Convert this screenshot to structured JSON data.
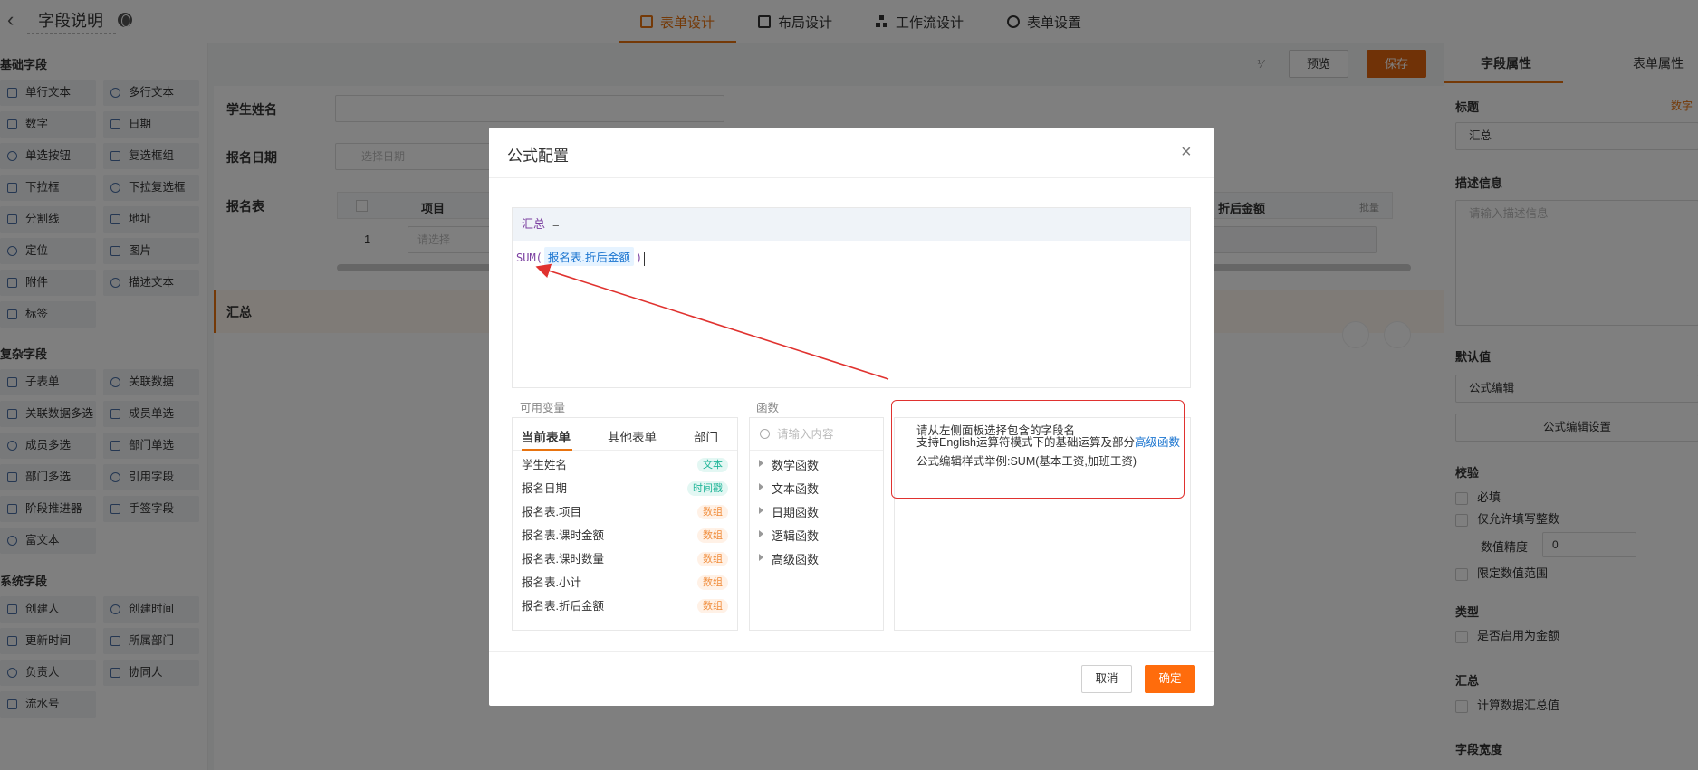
{
  "header": {
    "title": "字段说明",
    "tabs": [
      {
        "label": "表单设计",
        "active": true
      },
      {
        "label": "布局设计",
        "active": false
      },
      {
        "label": "工作流设计",
        "active": false
      },
      {
        "label": "表单设置",
        "active": false
      }
    ]
  },
  "palette": {
    "basic_title": "基础字段",
    "basic": [
      "单行文本",
      "多行文本",
      "数字",
      "日期",
      "单选按钮",
      "复选框组",
      "下拉框",
      "下拉复选框",
      "分割线",
      "地址",
      "定位",
      "图片",
      "附件",
      "描述文本",
      "标签"
    ],
    "complex_title": "复杂字段",
    "complex": [
      "子表单",
      "关联数据",
      "关联数据多选",
      "成员单选",
      "成员多选",
      "部门单选",
      "部门多选",
      "引用字段",
      "阶段推进器",
      "手签字段",
      "富文本"
    ],
    "system_title": "系统字段",
    "system": [
      "创建人",
      "创建时间",
      "更新时间",
      "所属部门",
      "负责人",
      "协同人",
      "流水号"
    ]
  },
  "toolbar": {
    "preview_label": "预览",
    "save_label": "保存"
  },
  "form": {
    "student_name_label": "学生姓名",
    "date_label": "报名日期",
    "date_placeholder": "选择日期",
    "table_label": "报名表",
    "table_col_item": "项目",
    "table_col_discount": "折后金额",
    "table_batch": "批量",
    "table_row_index": "1",
    "table_select_placeholder": "请选择",
    "sum_label": "汇总"
  },
  "right_panel": {
    "tabs": [
      "字段属性",
      "表单属性"
    ],
    "title_label": "标题",
    "title_type": "数字",
    "title_value": "汇总",
    "desc_label": "描述信息",
    "desc_placeholder": "请输入描述信息",
    "default_label": "默认值",
    "default_value": "公式编辑",
    "formula_button": "公式编辑设置",
    "validation_label": "校验",
    "required": "必填",
    "integer_only": "仅允许填写整数",
    "precision_label": "数值精度",
    "precision_value": "0",
    "range_limit": "限定数值范围",
    "type_label": "类型",
    "currency": "是否启用为金额",
    "summary_label": "汇总",
    "calc_summary": "计算数据汇总值",
    "width_label": "字段宽度"
  },
  "modal": {
    "title": "公式配置",
    "formula_name": "汇总",
    "formula_eq": "=",
    "formula_fn": "SUM(",
    "formula_field": "报名表.折后金额",
    "formula_close": ")",
    "vars_label": "可用变量",
    "var_tabs": [
      "当前表单",
      "其他表单",
      "部门"
    ],
    "variables": [
      {
        "name": "学生姓名",
        "type": "文本",
        "kind": "text"
      },
      {
        "name": "报名日期",
        "type": "时间戳",
        "kind": "time"
      },
      {
        "name": "报名表.项目",
        "type": "数组",
        "kind": "arr"
      },
      {
        "name": "报名表.课时金额",
        "type": "数组",
        "kind": "arr"
      },
      {
        "name": "报名表.课时数量",
        "type": "数组",
        "kind": "arr"
      },
      {
        "name": "报名表.小计",
        "type": "数组",
        "kind": "arr"
      },
      {
        "name": "报名表.折后金额",
        "type": "数组",
        "kind": "arr"
      }
    ],
    "fn_label": "函数",
    "fn_search_placeholder": "请输入内容",
    "functions": [
      "数学函数",
      "文本函数",
      "日期函数",
      "逻辑函数",
      "高级函数"
    ],
    "help_line1": "请从左侧面板选择包含的字段名",
    "help_line2a": "支持English运算符模式下的基础运算及部分",
    "help_line2_link": "高级函数",
    "help_line3": "公式编辑样式举例:SUM(基本工资,加班工资)",
    "cancel_label": "取消",
    "ok_label": "确定"
  },
  "colors": {
    "accent": "#e8730f",
    "primary_button": "#ff6c0c",
    "annotation": "#e0322f",
    "link": "#1b75d0"
  }
}
